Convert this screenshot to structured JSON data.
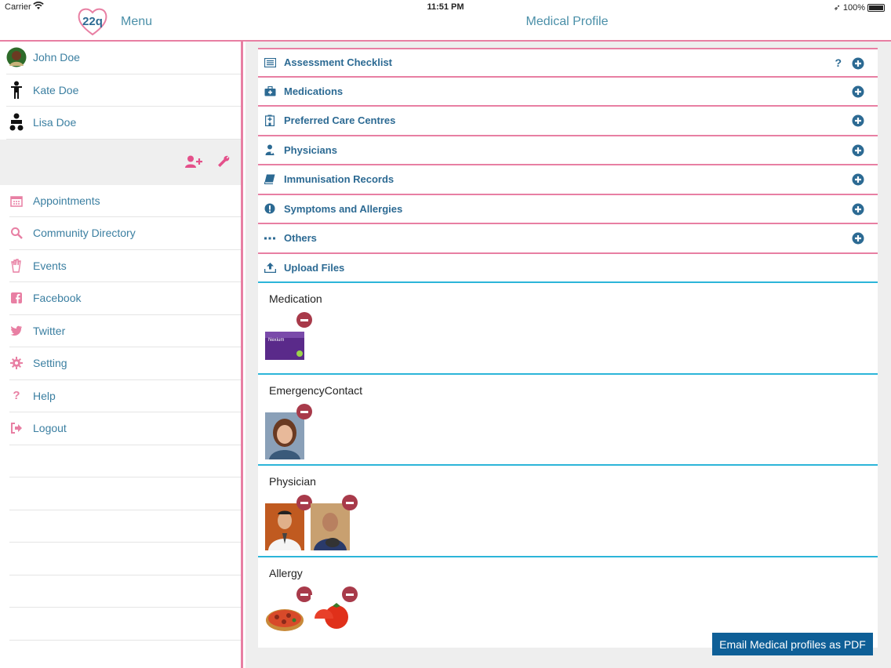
{
  "statusbar": {
    "carrier": "Carrier",
    "time": "11:51 PM",
    "battery": "100%"
  },
  "header": {
    "logo_text": "22q",
    "menu_title": "Menu",
    "page_title": "Medical Profile"
  },
  "profiles": [
    {
      "name": "John Doe",
      "icon": "avatar-photo"
    },
    {
      "name": "Kate Doe",
      "icon": "child-icon"
    },
    {
      "name": "Lisa Doe",
      "icon": "baby-icon"
    }
  ],
  "nav": [
    {
      "label": "Appointments",
      "icon": "calendar-icon"
    },
    {
      "label": "Community Directory",
      "icon": "search-icon"
    },
    {
      "label": "Events",
      "icon": "hand-icon"
    },
    {
      "label": "Facebook",
      "icon": "facebook-icon"
    },
    {
      "label": "Twitter",
      "icon": "twitter-icon"
    },
    {
      "label": "Setting",
      "icon": "gear-icon"
    },
    {
      "label": "Help",
      "icon": "question-icon"
    },
    {
      "label": "Logout",
      "icon": "logout-icon"
    }
  ],
  "sections": [
    {
      "label": "Assessment Checklist",
      "icon": "list-icon",
      "help": "?"
    },
    {
      "label": "Medications",
      "icon": "medkit-icon"
    },
    {
      "label": "Preferred Care Centres",
      "icon": "hospital-icon"
    },
    {
      "label": "Physicians",
      "icon": "doctor-icon"
    },
    {
      "label": "Immunisation Records",
      "icon": "book-icon"
    },
    {
      "label": "Symptoms and Allergies",
      "icon": "exclamation-icon"
    },
    {
      "label": "Others",
      "icon": "ellipsis-icon"
    },
    {
      "label": "Upload Files",
      "icon": "upload-icon"
    }
  ],
  "blocks": [
    {
      "title": "Medication",
      "items": [
        "medication-box"
      ]
    },
    {
      "title": "EmergencyContact",
      "items": [
        "woman-photo"
      ]
    },
    {
      "title": "Physician",
      "items": [
        "doctor-photo",
        "man-photo"
      ]
    },
    {
      "title": "Allergy",
      "items": [
        "pizza-photo",
        "tomato-photo"
      ]
    }
  ],
  "email_button": "Email Medical profiles as PDF",
  "colors": {
    "accent_pink": "#e87fa3",
    "accent_blue": "#2cb5d9",
    "text_blue": "#2c6a93",
    "button_blue": "#0e5f97"
  }
}
